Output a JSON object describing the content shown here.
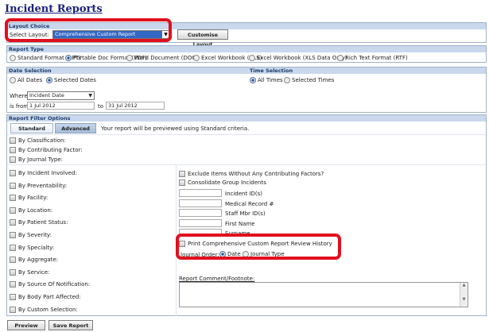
{
  "page": {
    "title": "Incident Reports"
  },
  "layout": {
    "header": "Layout Choice",
    "select_label": "Select Layout:",
    "selected": "Comprehensive Custom Report",
    "customise_button": "Customise Layout"
  },
  "report_type": {
    "header": "Report Type",
    "options": [
      {
        "label": "Standard Format (RPT)",
        "checked": false
      },
      {
        "label": "Portable Doc Format (PDF)",
        "checked": true
      },
      {
        "label": "Word Document (DOC)",
        "checked": false
      },
      {
        "label": "Excel Workbook (XLS)",
        "checked": false
      },
      {
        "label": "Excel Workbook (XLS Data Only)",
        "checked": false
      },
      {
        "label": "Rich Text Format (RTF)",
        "checked": false
      }
    ]
  },
  "date_selection": {
    "header": "Date Selection",
    "all_label": "All Dates",
    "selected_label": "Selected Dates",
    "where_label": "Where",
    "where_value": "Incident Date",
    "from_label": "is from",
    "from_value": "1 Jul 2012",
    "to_label": "to",
    "to_value": "31 Jul 2012"
  },
  "time_selection": {
    "header": "Time Selection",
    "all_label": "All Times",
    "selected_label": "Selected Times"
  },
  "filter": {
    "header": "Report Filter Options",
    "tab_standard": "Standard",
    "tab_advanced": "Advanced",
    "preview_note": "Your report will be previewed using Standard criteria.",
    "top_items": [
      "By Classification:",
      "By Contributing Factor:",
      "By Journal Type:"
    ],
    "left_items": [
      "By Incident Involved:",
      "By Preventability:",
      "By Facility:",
      "By Location:",
      "By Patient Status:",
      "By Severity:",
      "By Specialty:",
      "By Aggregate:",
      "By Service:",
      "By Source Of Notification:",
      "By Body Part Affected:",
      "By Custom Selection:"
    ],
    "exclude_label": "Exclude Items Without Any Contributing Factors?",
    "consolidate_label": "Consolidate Group Incidents",
    "fields": [
      "Incident ID(s)",
      "Medical Record #",
      "Staff Mbr ID(s)",
      "First Name",
      "Surname"
    ],
    "print_history_label": "Print Comprehensive Custom Report Review History",
    "journal_order_label": "Journal Order:",
    "journal_date": "Date",
    "journal_type": "Journal Type",
    "comment_label": "Report Comment/Footnote:"
  },
  "buttons": {
    "preview": "Preview",
    "save": "Save Report"
  }
}
